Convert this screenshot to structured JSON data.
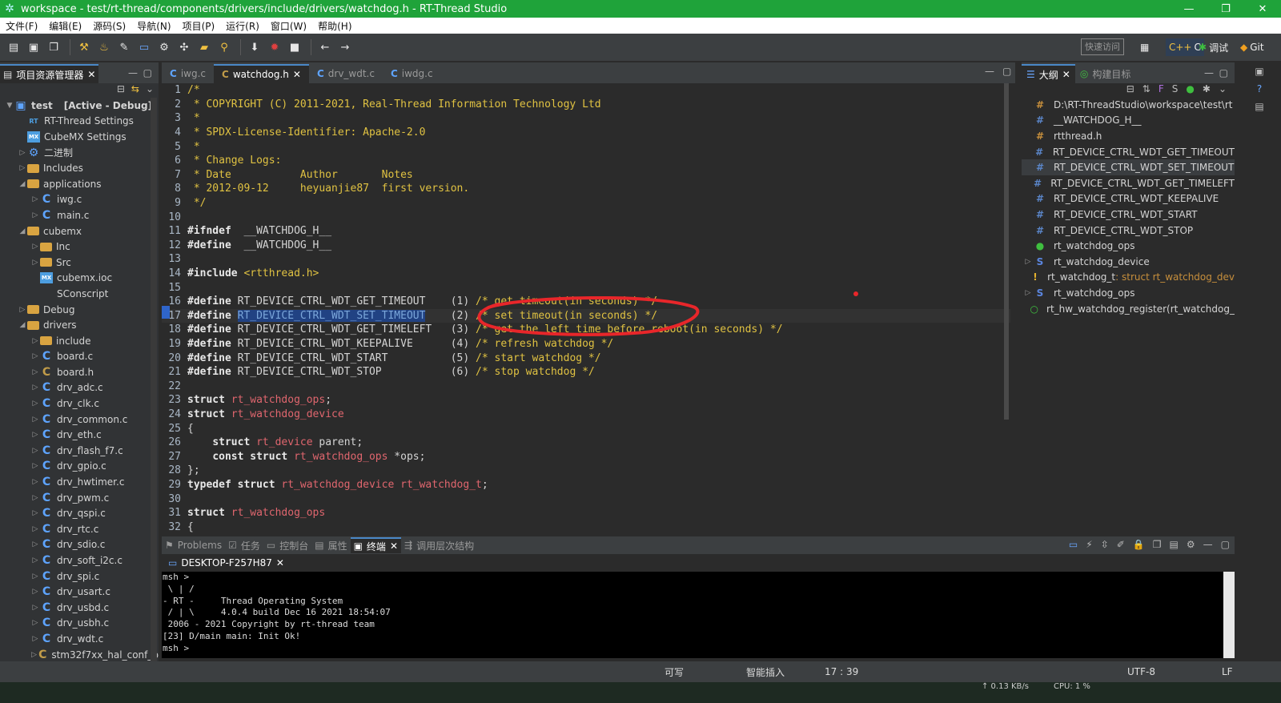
{
  "window": {
    "title": "workspace - test/rt-thread/components/drivers/include/drivers/watchdog.h - RT-Thread Studio",
    "minimize": "—",
    "maximize": "❐",
    "close": "✕"
  },
  "menu": [
    "文件(F)",
    "编辑(E)",
    "源码(S)",
    "导航(N)",
    "项目(P)",
    "运行(R)",
    "窗口(W)",
    "帮助(H)"
  ],
  "toolbar": {
    "quick_access_placeholder": "快速访问",
    "perspectives": [
      "C",
      "调试",
      "Git"
    ]
  },
  "explorer": {
    "title": "项目资源管理器",
    "items": [
      {
        "label": "test",
        "extra": "[Active - Debug]",
        "type": "project",
        "depth": 0,
        "arrow": "▼"
      },
      {
        "label": "RT-Thread Settings",
        "type": "rt",
        "depth": 1,
        "arrow": ""
      },
      {
        "label": "CubeMX Settings",
        "type": "mx",
        "depth": 1,
        "arrow": ""
      },
      {
        "label": "二进制",
        "type": "bin",
        "depth": 1,
        "arrow": "▷"
      },
      {
        "label": "Includes",
        "type": "folder",
        "depth": 1,
        "arrow": "▷"
      },
      {
        "label": "applications",
        "type": "folder",
        "depth": 1,
        "arrow": "◢"
      },
      {
        "label": "iwg.c",
        "type": "c",
        "depth": 2,
        "arrow": "▷"
      },
      {
        "label": "main.c",
        "type": "c",
        "depth": 2,
        "arrow": "▷"
      },
      {
        "label": "cubemx",
        "type": "folder",
        "depth": 1,
        "arrow": "◢"
      },
      {
        "label": "Inc",
        "type": "folder",
        "depth": 2,
        "arrow": "▷"
      },
      {
        "label": "Src",
        "type": "folder",
        "depth": 2,
        "arrow": "▷"
      },
      {
        "label": "cubemx.ioc",
        "type": "mx",
        "depth": 2,
        "arrow": ""
      },
      {
        "label": "SConscript",
        "type": "file",
        "depth": 2,
        "arrow": ""
      },
      {
        "label": "Debug",
        "type": "folder",
        "depth": 1,
        "arrow": "▷"
      },
      {
        "label": "drivers",
        "type": "folder",
        "depth": 1,
        "arrow": "◢"
      },
      {
        "label": "include",
        "type": "folder",
        "depth": 2,
        "arrow": "▷"
      },
      {
        "label": "board.c",
        "type": "c",
        "depth": 2,
        "arrow": "▷"
      },
      {
        "label": "board.h",
        "type": "h",
        "depth": 2,
        "arrow": "▷"
      },
      {
        "label": "drv_adc.c",
        "type": "c",
        "depth": 2,
        "arrow": "▷"
      },
      {
        "label": "drv_clk.c",
        "type": "c",
        "depth": 2,
        "arrow": "▷"
      },
      {
        "label": "drv_common.c",
        "type": "c",
        "depth": 2,
        "arrow": "▷"
      },
      {
        "label": "drv_eth.c",
        "type": "c",
        "depth": 2,
        "arrow": "▷"
      },
      {
        "label": "drv_flash_f7.c",
        "type": "c",
        "depth": 2,
        "arrow": "▷"
      },
      {
        "label": "drv_gpio.c",
        "type": "c",
        "depth": 2,
        "arrow": "▷"
      },
      {
        "label": "drv_hwtimer.c",
        "type": "c",
        "depth": 2,
        "arrow": "▷"
      },
      {
        "label": "drv_pwm.c",
        "type": "c",
        "depth": 2,
        "arrow": "▷"
      },
      {
        "label": "drv_qspi.c",
        "type": "c",
        "depth": 2,
        "arrow": "▷"
      },
      {
        "label": "drv_rtc.c",
        "type": "c",
        "depth": 2,
        "arrow": "▷"
      },
      {
        "label": "drv_sdio.c",
        "type": "c",
        "depth": 2,
        "arrow": "▷"
      },
      {
        "label": "drv_soft_i2c.c",
        "type": "c",
        "depth": 2,
        "arrow": "▷"
      },
      {
        "label": "drv_spi.c",
        "type": "c",
        "depth": 2,
        "arrow": "▷"
      },
      {
        "label": "drv_usart.c",
        "type": "c",
        "depth": 2,
        "arrow": "▷"
      },
      {
        "label": "drv_usbd.c",
        "type": "c",
        "depth": 2,
        "arrow": "▷"
      },
      {
        "label": "drv_usbh.c",
        "type": "c",
        "depth": 2,
        "arrow": "▷"
      },
      {
        "label": "drv_wdt.c",
        "type": "c",
        "depth": 2,
        "arrow": "▷"
      },
      {
        "label": "stm32f7xx_hal_conf_b",
        "type": "h",
        "depth": 2,
        "arrow": "▷"
      }
    ]
  },
  "editor": {
    "tabs": [
      {
        "label": "iwg.c",
        "active": false,
        "closable": false
      },
      {
        "label": "watchdog.h",
        "active": true,
        "closable": true
      },
      {
        "label": "drv_wdt.c",
        "active": false,
        "closable": false
      },
      {
        "label": "iwdg.c",
        "active": false,
        "closable": false
      }
    ],
    "current_line": 17,
    "lines": [
      {
        "n": "1",
        "fold": true,
        "parts": [
          [
            "cm",
            "/*"
          ]
        ]
      },
      {
        "n": "2",
        "parts": [
          [
            "cm",
            " * COPYRIGHT (C) 2011-2021, Real-Thread Information Technology Ltd"
          ]
        ]
      },
      {
        "n": "3",
        "parts": [
          [
            "cm",
            " *"
          ]
        ]
      },
      {
        "n": "4",
        "parts": [
          [
            "cm",
            " * SPDX-License-Identifier: Apache-2.0"
          ]
        ]
      },
      {
        "n": "5",
        "parts": [
          [
            "cm",
            " *"
          ]
        ]
      },
      {
        "n": "6",
        "parts": [
          [
            "cm",
            " * Change Logs:"
          ]
        ]
      },
      {
        "n": "7",
        "parts": [
          [
            "cm",
            " * Date           Author       Notes"
          ]
        ]
      },
      {
        "n": "8",
        "parts": [
          [
            "cm",
            " * 2012-09-12     heyuanjie87  first version."
          ]
        ]
      },
      {
        "n": "9",
        "parts": [
          [
            "cm",
            " */"
          ]
        ]
      },
      {
        "n": "10",
        "parts": []
      },
      {
        "n": "11",
        "parts": [
          [
            "kw",
            "#ifndef"
          ],
          [
            "",
            "  __WATCHDOG_H__"
          ]
        ]
      },
      {
        "n": "12",
        "parts": [
          [
            "kw",
            "#define"
          ],
          [
            "",
            "  __WATCHDOG_H__"
          ]
        ]
      },
      {
        "n": "13",
        "parts": []
      },
      {
        "n": "14",
        "parts": [
          [
            "kw",
            "#include"
          ],
          [
            "",
            " "
          ],
          [
            "cm",
            "<rtthread.h>"
          ]
        ]
      },
      {
        "n": "15",
        "parts": []
      },
      {
        "n": "16",
        "parts": [
          [
            "kw",
            "#define"
          ],
          [
            "",
            " RT_DEVICE_CTRL_WDT_GET_TIMEOUT    (1) "
          ],
          [
            "cm",
            "/* get timeout(in seconds) */"
          ]
        ]
      },
      {
        "n": "17",
        "parts": [
          [
            "kw",
            "#define"
          ],
          [
            "",
            " "
          ],
          [
            "sel",
            "RT_DEVICE_CTRL_WDT_SET_TIMEOUT"
          ],
          [
            "",
            "    (2) "
          ],
          [
            "cm",
            "/* set timeout(in seconds) */"
          ]
        ]
      },
      {
        "n": "18",
        "parts": [
          [
            "kw",
            "#define"
          ],
          [
            "",
            " RT_DEVICE_CTRL_WDT_GET_TIMELEFT   (3) "
          ],
          [
            "cm",
            "/* get the left time before reboot(in seconds) */"
          ]
        ]
      },
      {
        "n": "19",
        "parts": [
          [
            "kw",
            "#define"
          ],
          [
            "",
            " RT_DEVICE_CTRL_WDT_KEEPALIVE      (4) "
          ],
          [
            "cm",
            "/* refresh watchdog */"
          ]
        ]
      },
      {
        "n": "20",
        "parts": [
          [
            "kw",
            "#define"
          ],
          [
            "",
            " RT_DEVICE_CTRL_WDT_START          (5) "
          ],
          [
            "cm",
            "/* start watchdog */"
          ]
        ]
      },
      {
        "n": "21",
        "parts": [
          [
            "kw",
            "#define"
          ],
          [
            "",
            " RT_DEVICE_CTRL_WDT_STOP           (6) "
          ],
          [
            "cm",
            "/* stop watchdog */"
          ]
        ]
      },
      {
        "n": "22",
        "parts": []
      },
      {
        "n": "23",
        "parts": [
          [
            "kw",
            "struct"
          ],
          [
            "",
            " "
          ],
          [
            "tp",
            "rt_watchdog_ops"
          ],
          [
            "",
            ";"
          ]
        ]
      },
      {
        "n": "24",
        "fold": true,
        "parts": [
          [
            "kw",
            "struct"
          ],
          [
            "",
            " "
          ],
          [
            "tp",
            "rt_watchdog_device"
          ]
        ]
      },
      {
        "n": "25",
        "parts": [
          [
            "",
            "{"
          ]
        ]
      },
      {
        "n": "26",
        "parts": [
          [
            "",
            "    "
          ],
          [
            "kw",
            "struct"
          ],
          [
            "",
            " "
          ],
          [
            "tp",
            "rt_device"
          ],
          [
            "",
            " parent;"
          ]
        ]
      },
      {
        "n": "27",
        "parts": [
          [
            "",
            "    "
          ],
          [
            "kw",
            "const struct"
          ],
          [
            "",
            " "
          ],
          [
            "tp",
            "rt_watchdog_ops"
          ],
          [
            "",
            " *ops;"
          ]
        ]
      },
      {
        "n": "28",
        "parts": [
          [
            "",
            "};"
          ]
        ]
      },
      {
        "n": "29",
        "parts": [
          [
            "kw",
            "typedef struct"
          ],
          [
            "",
            " "
          ],
          [
            "tp",
            "rt_watchdog_device rt_watchdog_t"
          ],
          [
            "",
            ";"
          ]
        ]
      },
      {
        "n": "30",
        "parts": []
      },
      {
        "n": "31",
        "fold": true,
        "parts": [
          [
            "kw",
            "struct"
          ],
          [
            "",
            " "
          ],
          [
            "tp",
            "rt_watchdog_ops"
          ]
        ]
      },
      {
        "n": "32",
        "parts": [
          [
            "",
            "{"
          ]
        ]
      }
    ]
  },
  "outline": {
    "tabs": [
      {
        "label": "大纲",
        "active": true
      },
      {
        "label": "构建目标",
        "active": false
      }
    ],
    "items": [
      {
        "label": "D:\\RT-ThreadStudio\\workspace\\test\\rt",
        "icon": "#",
        "color": "#c78f3c",
        "arrow": ""
      },
      {
        "label": "__WATCHDOG_H__",
        "icon": "#",
        "color": "#5b86c9",
        "arrow": ""
      },
      {
        "label": "rtthread.h",
        "icon": "#",
        "color": "#c78f3c",
        "arrow": ""
      },
      {
        "label": "RT_DEVICE_CTRL_WDT_GET_TIMEOUT",
        "icon": "#",
        "color": "#5b86c9",
        "arrow": ""
      },
      {
        "label": "RT_DEVICE_CTRL_WDT_SET_TIMEOUT",
        "icon": "#",
        "color": "#5b86c9",
        "arrow": "",
        "selected": true
      },
      {
        "label": "RT_DEVICE_CTRL_WDT_GET_TIMELEFT",
        "icon": "#",
        "color": "#5b86c9",
        "arrow": ""
      },
      {
        "label": "RT_DEVICE_CTRL_WDT_KEEPALIVE",
        "icon": "#",
        "color": "#5b86c9",
        "arrow": ""
      },
      {
        "label": "RT_DEVICE_CTRL_WDT_START",
        "icon": "#",
        "color": "#5b86c9",
        "arrow": ""
      },
      {
        "label": "RT_DEVICE_CTRL_WDT_STOP",
        "icon": "#",
        "color": "#5b86c9",
        "arrow": ""
      },
      {
        "label": "rt_watchdog_ops",
        "icon": "●",
        "color": "#3fbf3f",
        "arrow": ""
      },
      {
        "label": "rt_watchdog_device",
        "icon": "S",
        "color": "#5b86e0",
        "arrow": "▷"
      },
      {
        "label": "rt_watchdog_t",
        "suffix": " : struct rt_watchdog_dev",
        "icon": "!",
        "color": "#e5b22e",
        "arrow": ""
      },
      {
        "label": "rt_watchdog_ops",
        "icon": "S",
        "color": "#5b86e0",
        "arrow": "▷"
      },
      {
        "label": "rt_hw_watchdog_register(rt_watchdog_",
        "icon": "○",
        "color": "#3fbf3f",
        "arrow": ""
      }
    ]
  },
  "console": {
    "tabs": [
      "Problems",
      "任务",
      "控制台",
      "属性",
      "终端",
      "调用层次结构"
    ],
    "active_tab": "终端",
    "session_tab": "DESKTOP-F257H87",
    "lines": [
      "msh >",
      " \\ | /",
      "- RT -     Thread Operating System",
      " / | \\     4.0.4 build Dec 16 2021 18:54:07",
      " 2006 - 2021 Copyright by rt-thread team",
      "[23] D/main main: Init Ok!",
      "msh >"
    ]
  },
  "status": {
    "writable": "可写",
    "insert_mode": "智能插入",
    "position": "17 : 39",
    "encoding": "UTF-8",
    "line_ending": "LF"
  },
  "taskbar": {
    "net": "↑ 0.13 KB/s",
    "cpu": "CPU: 1 %"
  },
  "colors": {
    "title_bar": "#1fa33a",
    "annotation": "#e8262a",
    "selection": "#214283"
  }
}
